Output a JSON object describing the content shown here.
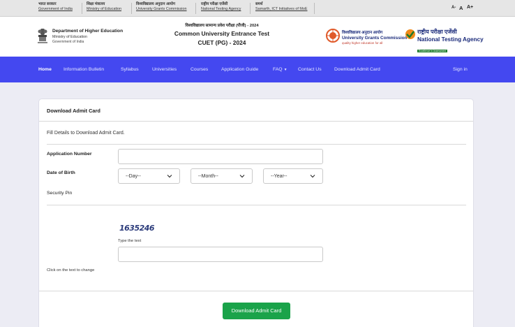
{
  "gov_strip": {
    "links": [
      {
        "hi": "भारत सरकार",
        "en": "Government of India"
      },
      {
        "hi": "शिक्षा मंत्रालय",
        "en": "Ministry of Education"
      },
      {
        "hi": "विश्वविद्यालय अनुदान आयोग",
        "en": "University Grants Commission"
      },
      {
        "hi": "राष्ट्रीय परीक्षा एजेंसी",
        "en": "National Testing Agency"
      },
      {
        "hi": "समर्थ",
        "en": "Samarth, ICT Initiatives of MoE"
      }
    ],
    "font_controls": [
      "A-",
      "A",
      "A+"
    ]
  },
  "header": {
    "dept": {
      "line1": "Department of Higher Education",
      "line2": "Ministry of Education",
      "line3": "Government of India"
    },
    "title_hi": "विश्वविद्यालय सामान्य प्रवेश परीक्षा (पीजी) - 2024",
    "title_en": "Common University Entrance Test",
    "title_short": "CUET (PG) - 2024",
    "ugc": {
      "hi": "विश्वविद्यालय अनुदान आयोग",
      "en": "University Grants Commission",
      "tagline": "quality higher education for all"
    },
    "nta": {
      "hi": "राष्ट्रीय परीक्षा एजेंसी",
      "en": "National Testing Agency",
      "tagline": "Excellence in Assessment"
    }
  },
  "nav": {
    "home": "Home",
    "info_bulletin": "Information Bulletin",
    "syllabus": "Syllabus",
    "universities": "Universities",
    "courses": "Courses",
    "application_guide": "Application Guide",
    "faq": "FAQ",
    "contact": "Contact Us",
    "download": "Download Admit Card",
    "signin": "Sign in"
  },
  "form": {
    "title": "Download Admit Card",
    "intro": "Fill Details to Download Admit Card.",
    "app_number_label": "Application Number",
    "app_number_value": "",
    "dob_label": "Date of Birth",
    "day": "--Day--",
    "month": "--Month--",
    "year": "--Year--",
    "security_pin_label": "Security Pin",
    "captcha_text": "1635246",
    "type_text_label": "Type the text",
    "captcha_value": "",
    "refresh_hint": "Click on the text to change",
    "submit_label": "Download Admit Card"
  },
  "colors": {
    "nav_bg": "#4448f0",
    "submit_bg": "#1aa34a",
    "page_bg": "#ececf4"
  }
}
